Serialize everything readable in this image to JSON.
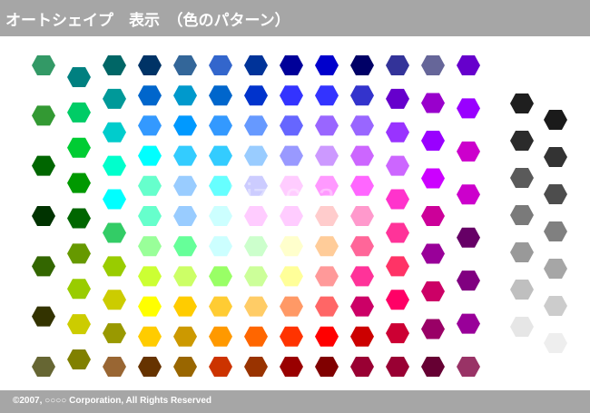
{
  "header": {
    "title": "オートシェイプ　表示　（色のパターン）"
  },
  "footer": {
    "copyright": "©2007, ○○○○ Corporation, All Rights Reserved"
  },
  "swatch_shape": "hexagon",
  "palette": {
    "staggered_columns": [
      [
        "#339966",
        "#339933",
        "#006600",
        "#003300",
        "#336600",
        "#333300",
        "#666633"
      ],
      [
        "#008080",
        "#00cc66",
        "#00cc33",
        "#009900",
        "#006600",
        "#669900",
        "#99cc00",
        "#cccc00",
        "#808000"
      ],
      [
        "#006666",
        "#009999",
        "#00cccc",
        "#00ffcc",
        "#00ffff",
        "#33cc66",
        "#99cc00",
        "#cccc00",
        "#999900",
        "#996633"
      ],
      [
        "#003366",
        "#0066cc",
        "#3399ff",
        "#00ffff",
        "#66ffcc",
        "#66ffcc",
        "#99ff99",
        "#ccff33",
        "#ffff00",
        "#ffcc00",
        "#663300"
      ],
      [
        "#336699",
        "#0099cc",
        "#0099ff",
        "#33ccff",
        "#99ccff",
        "#99ccff",
        "#66ff99",
        "#ccff66",
        "#ffcc00",
        "#cc9900",
        "#996600"
      ],
      [
        "#3366cc",
        "#0066cc",
        "#3399ff",
        "#33ccff",
        "#66ffff",
        "#ccffff",
        "#ccffff",
        "#99ff66",
        "#ffcc33",
        "#ff9900",
        "#cc3300"
      ],
      [
        "#003399",
        "#0033cc",
        "#6699ff",
        "#99ccff",
        "#ccccff",
        "#ffccff",
        "#ccffcc",
        "#ccff99",
        "#ffcc66",
        "#ff6600",
        "#993300"
      ],
      [
        "#000099",
        "#3333ff",
        "#6666ff",
        "#9999ff",
        "#ffccff",
        "#ffccff",
        "#ffffcc",
        "#ffff99",
        "#ff9966",
        "#ff3300",
        "#990000"
      ],
      [
        "#0000cc",
        "#3333ff",
        "#9966ff",
        "#cc99ff",
        "#ff99ff",
        "#ffcccc",
        "#ffcc99",
        "#ff9999",
        "#ff6666",
        "#ff0000",
        "#800000"
      ],
      [
        "#000066",
        "#3333cc",
        "#9966ff",
        "#cc66ff",
        "#ff66ff",
        "#ff99cc",
        "#ff6699",
        "#ff3399",
        "#cc0066",
        "#cc0000",
        "#990033"
      ],
      [
        "#333399",
        "#6600cc",
        "#9933ff",
        "#cc66ff",
        "#ff33cc",
        "#ff3399",
        "#ff3366",
        "#ff0066",
        "#cc0033",
        "#990033"
      ],
      [
        "#666699",
        "#9900cc",
        "#9900ff",
        "#cc00ff",
        "#cc0099",
        "#990099",
        "#cc0066",
        "#990066",
        "#660033"
      ],
      [
        "#6600cc",
        "#9900ff",
        "#cc00cc",
        "#cc00cc",
        "#660066",
        "#800080",
        "#990099",
        "#993366"
      ]
    ],
    "gray_columns": [
      [
        "#1f1f1f",
        "#2b2b2b",
        "#5a5a5a",
        "#7a7a7a",
        "#999999",
        "#bfbfbf",
        "#e6e6e6"
      ],
      [
        "#1a1a1a",
        "#333333",
        "#4d4d4d",
        "#808080",
        "#a6a6a6",
        "#cccccc",
        "#eeeeee"
      ]
    ]
  }
}
